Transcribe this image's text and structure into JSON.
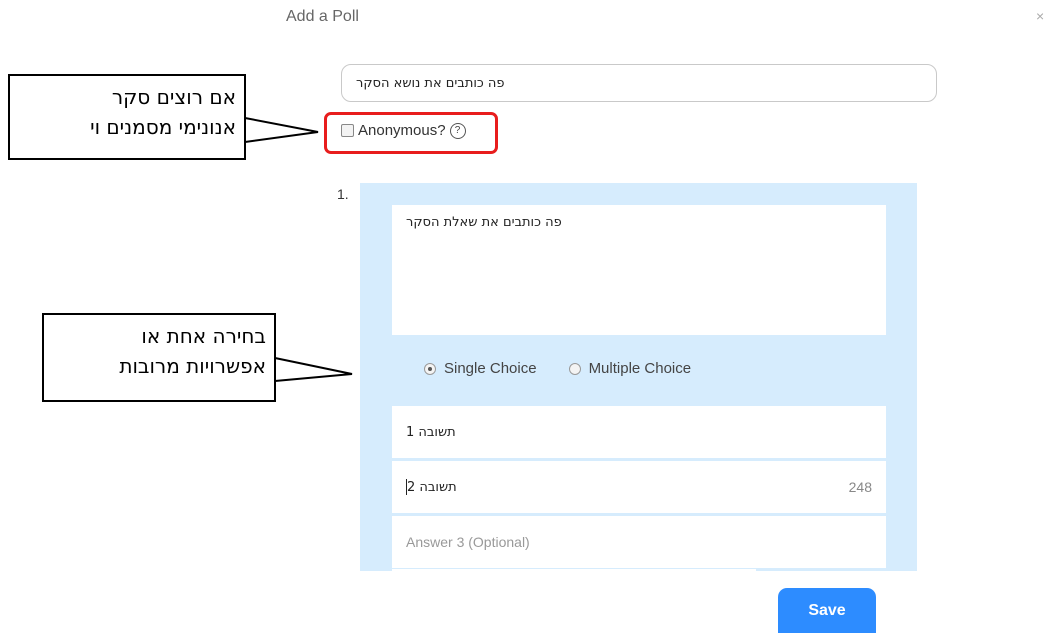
{
  "dialog": {
    "title": "Add a Poll",
    "close_label": "×"
  },
  "topic": {
    "value": "פה כותבים את נושא הסקר"
  },
  "anonymous": {
    "label": "Anonymous?",
    "checked": false,
    "help_glyph": "?",
    "highlight_color": "#e81d1d"
  },
  "question": {
    "number": "1.",
    "text": "פה כותבים את שאלת הסקר",
    "panel_color": "#d6ecfd",
    "choice_types": [
      {
        "label": "Single Choice",
        "selected": true
      },
      {
        "label": "Multiple Choice",
        "selected": false
      }
    ],
    "answers": [
      {
        "value": "תשובה 1",
        "placeholder": "",
        "char_count": ""
      },
      {
        "value": "תשובה 2",
        "placeholder": "",
        "char_count": "248"
      },
      {
        "value": "",
        "placeholder": "Answer 3 (Optional)",
        "char_count": ""
      }
    ]
  },
  "footer": {
    "save_label": "Save",
    "accent": "#2d8cff"
  },
  "callouts": [
    {
      "line1": "אם רוצים סקר",
      "line2": "אנונימי מסמנים וי"
    },
    {
      "line1": "בחירה אחת או",
      "line2": "אפשרויות מרובות"
    }
  ]
}
